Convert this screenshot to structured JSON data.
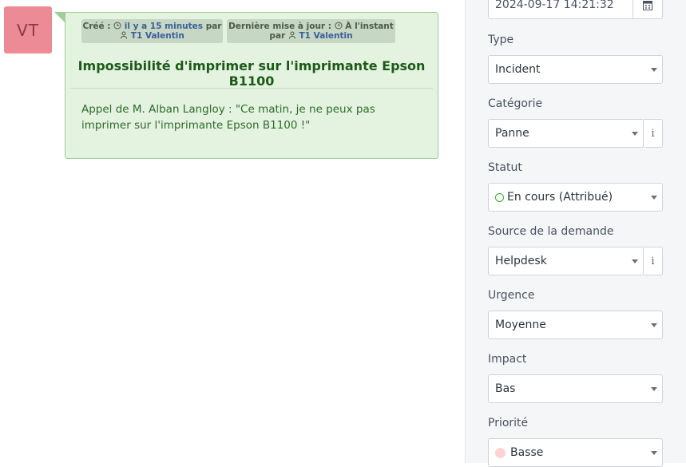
{
  "avatar": {
    "initials": "VT",
    "color": "#ec8a96"
  },
  "followup": {
    "created_prefix": "Créé :",
    "created_time": "il y a 15 minutes",
    "created_by_word": "par",
    "created_author": "T1 Valentin",
    "updated_prefix": "Dernière mise à jour :",
    "updated_time": "À l'instant",
    "updated_by_word": "par",
    "updated_author": "T1 Valentin",
    "title": "Impossibilité d'imprimer sur l'imprimante Epson B1100",
    "content": "Appel de M. Alban Langloy : \"Ce matin, je ne peux pas imprimer sur l'imprimante Epson B1100 !\"",
    "bg_color": "#e3f3e0"
  },
  "panel": {
    "date_value": "2024-09-17 14:21:32",
    "type": {
      "label": "Type",
      "value": "Incident"
    },
    "category": {
      "label": "Catégorie",
      "value": "Panne",
      "info": "i"
    },
    "status": {
      "label": "Statut",
      "value": "En cours (Attribué)"
    },
    "source": {
      "label": "Source de la demande",
      "value": "Helpdesk",
      "info": "i"
    },
    "urgency": {
      "label": "Urgence",
      "value": "Moyenne"
    },
    "impact": {
      "label": "Impact",
      "value": "Bas"
    },
    "priority": {
      "label": "Priorité",
      "value": "Basse"
    }
  }
}
